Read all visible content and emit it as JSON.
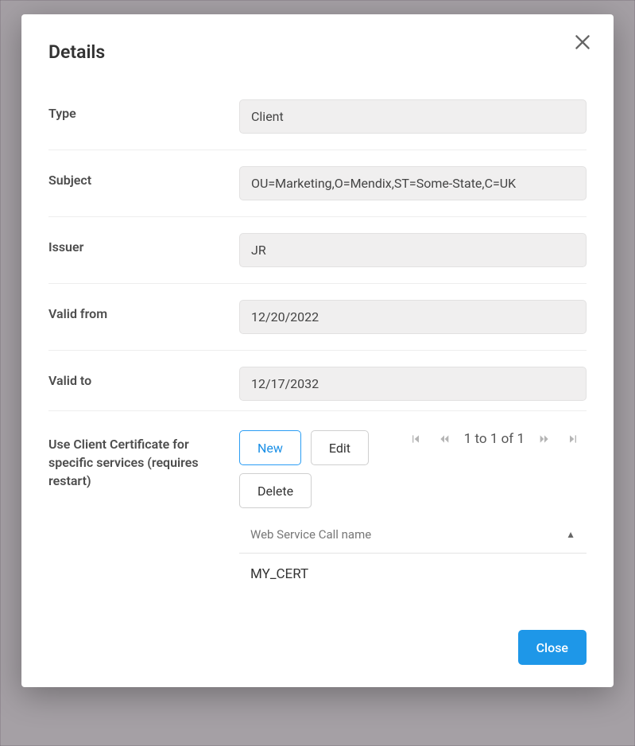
{
  "modal": {
    "title": "Details",
    "close_icon": "close-icon"
  },
  "fields": {
    "type": {
      "label": "Type",
      "value": "Client"
    },
    "subject": {
      "label": "Subject",
      "value": "OU=Marketing,O=Mendix,ST=Some-State,C=UK"
    },
    "issuer": {
      "label": "Issuer",
      "value": "JR"
    },
    "valid_from": {
      "label": "Valid from",
      "value": "12/20/2022"
    },
    "valid_to": {
      "label": "Valid to",
      "value": "12/17/2032"
    }
  },
  "services": {
    "label": "Use Client Certificate for specific services (requires restart)",
    "buttons": {
      "new": "New",
      "edit": "Edit",
      "delete": "Delete"
    },
    "pager": {
      "text": "1 to 1 of 1"
    },
    "table": {
      "column": "Web Service Call name",
      "rows": [
        "MY_CERT"
      ]
    }
  },
  "footer": {
    "close": "Close"
  }
}
